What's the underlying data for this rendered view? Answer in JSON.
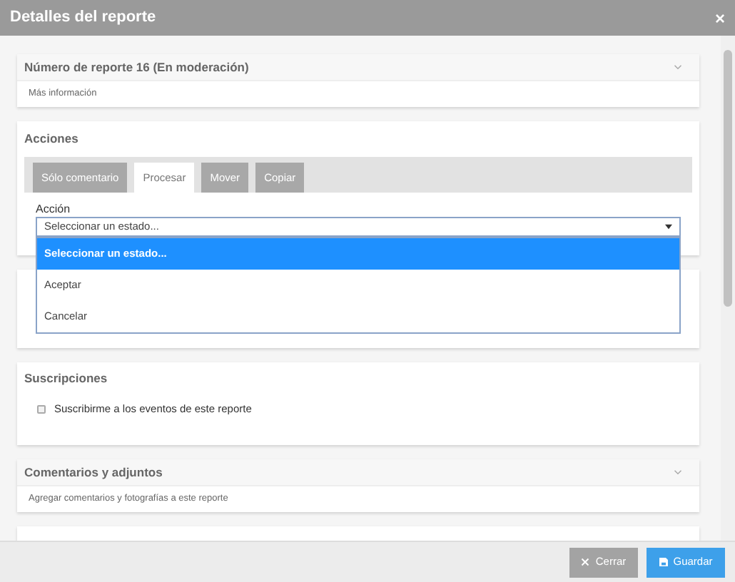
{
  "window": {
    "title": "Detalles del reporte",
    "close": "×"
  },
  "report": {
    "title": "Número de reporte 16 (En moderación)",
    "subtitle": "Más información"
  },
  "actions": {
    "title": "Acciones",
    "tabs": [
      {
        "label": "Sólo comentario",
        "selected": false
      },
      {
        "label": "Procesar",
        "selected": true
      },
      {
        "label": "Mover",
        "selected": false
      },
      {
        "label": "Copiar",
        "selected": false
      }
    ],
    "field_label": "Acción",
    "value": "Seleccionar un estado...",
    "open": true,
    "options": [
      {
        "label": "Seleccionar un estado...",
        "selected": true
      },
      {
        "label": "Aceptar",
        "selected": false
      },
      {
        "label": "Cancelar",
        "selected": false
      }
    ]
  },
  "subscriptions": {
    "title": "Suscripciones",
    "checkbox": {
      "label": "Suscribirme a los eventos de este reporte",
      "checked": false
    }
  },
  "comments": {
    "title": "Comentarios y adjuntos",
    "subtitle": "Agregar comentarios y fotografías a este reporte"
  },
  "buttons": [
    {
      "label": "Cerrar",
      "kind": "close"
    },
    {
      "label": "Guardar",
      "kind": "save"
    }
  ]
}
